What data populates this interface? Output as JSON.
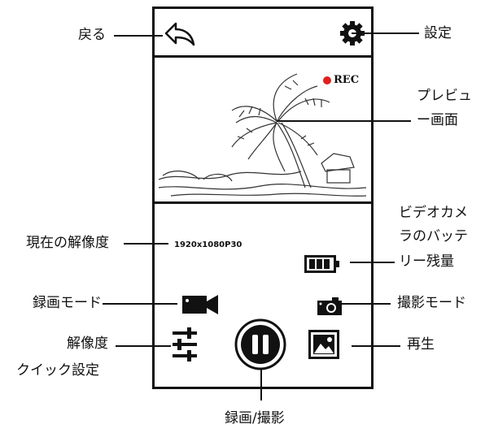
{
  "phone": {
    "rec_label": "REC",
    "resolution_text": "1920x1080P30"
  },
  "callouts": {
    "back": "戻る",
    "settings": "設定",
    "preview_line1": "プレビュ",
    "preview_line2": "ー画面",
    "current_resolution": "現在の解像度",
    "battery_line1": "ビデオカメ",
    "battery_line2": "ラのバッテ",
    "battery_line3": "リー残量",
    "video_mode": "録画モード",
    "photo_mode": "撮影モード",
    "resolution_quick_line1": "解像度",
    "resolution_quick_line2": "クイック設定",
    "playback": "再生",
    "record_shoot": "録画/撮影"
  },
  "icons": {
    "back": "back-arrow-icon",
    "settings": "gear-icon",
    "battery": "battery-icon",
    "video": "video-camera-icon",
    "photo": "camera-icon",
    "sliders": "sliders-icon",
    "pause": "pause-icon",
    "gallery": "image-gallery-icon"
  },
  "colors": {
    "rec_dot": "#e02020",
    "ink": "#111111"
  },
  "battery_level": 0.75
}
